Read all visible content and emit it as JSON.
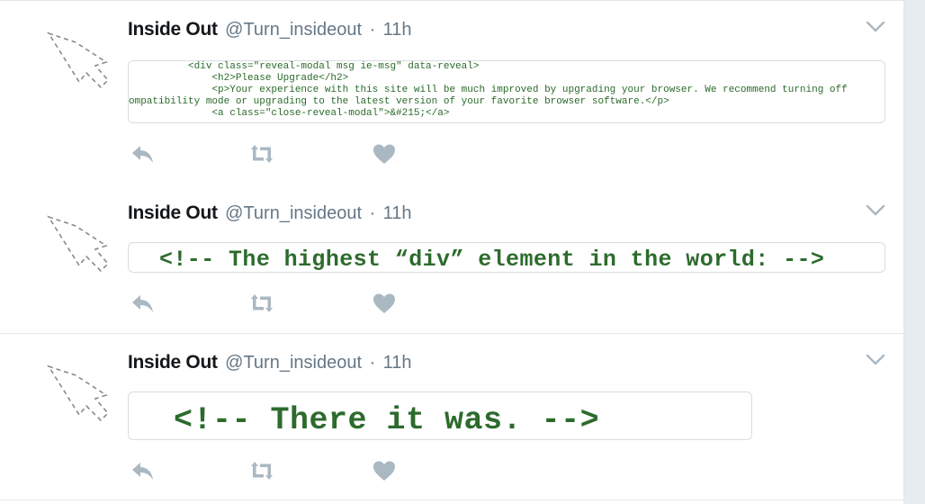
{
  "tweets": [
    {
      "author": "Inside Out",
      "handle": "@Turn_insideout",
      "separator": "·",
      "time": "11h",
      "code_lines": [
        "          <div class=\"reveal-modal msg ie-msg\" data-reveal>",
        "              <h2>Please Upgrade</h2>",
        "              <p>Your experience with this site will be much improved by upgrading your browser. We recommend turning off",
        "ompatibility mode or upgrading to the latest version of your favorite browser software.</p>",
        "              <a class=\"close-reveal-modal\">&#215;</a>",
        "            ..."
      ]
    },
    {
      "author": "Inside Out",
      "handle": "@Turn_insideout",
      "separator": "·",
      "time": "11h",
      "code_text": "<!-- The highest “div” element in the world: -->"
    },
    {
      "author": "Inside Out",
      "handle": "@Turn_insideout",
      "separator": "·",
      "time": "11h",
      "code_text": "<!-- There it was. -->"
    }
  ],
  "icons": {
    "avatar": "cursor-arrow-icon",
    "menu": "chevron-down-icon",
    "reply": "reply-icon",
    "retweet": "retweet-icon",
    "like": "heart-icon"
  },
  "colors": {
    "name": "#14171a",
    "meta": "#657786",
    "action_icon": "#aab8c2",
    "code_green": "#2d6b2d",
    "border": "#e1e8ed"
  }
}
